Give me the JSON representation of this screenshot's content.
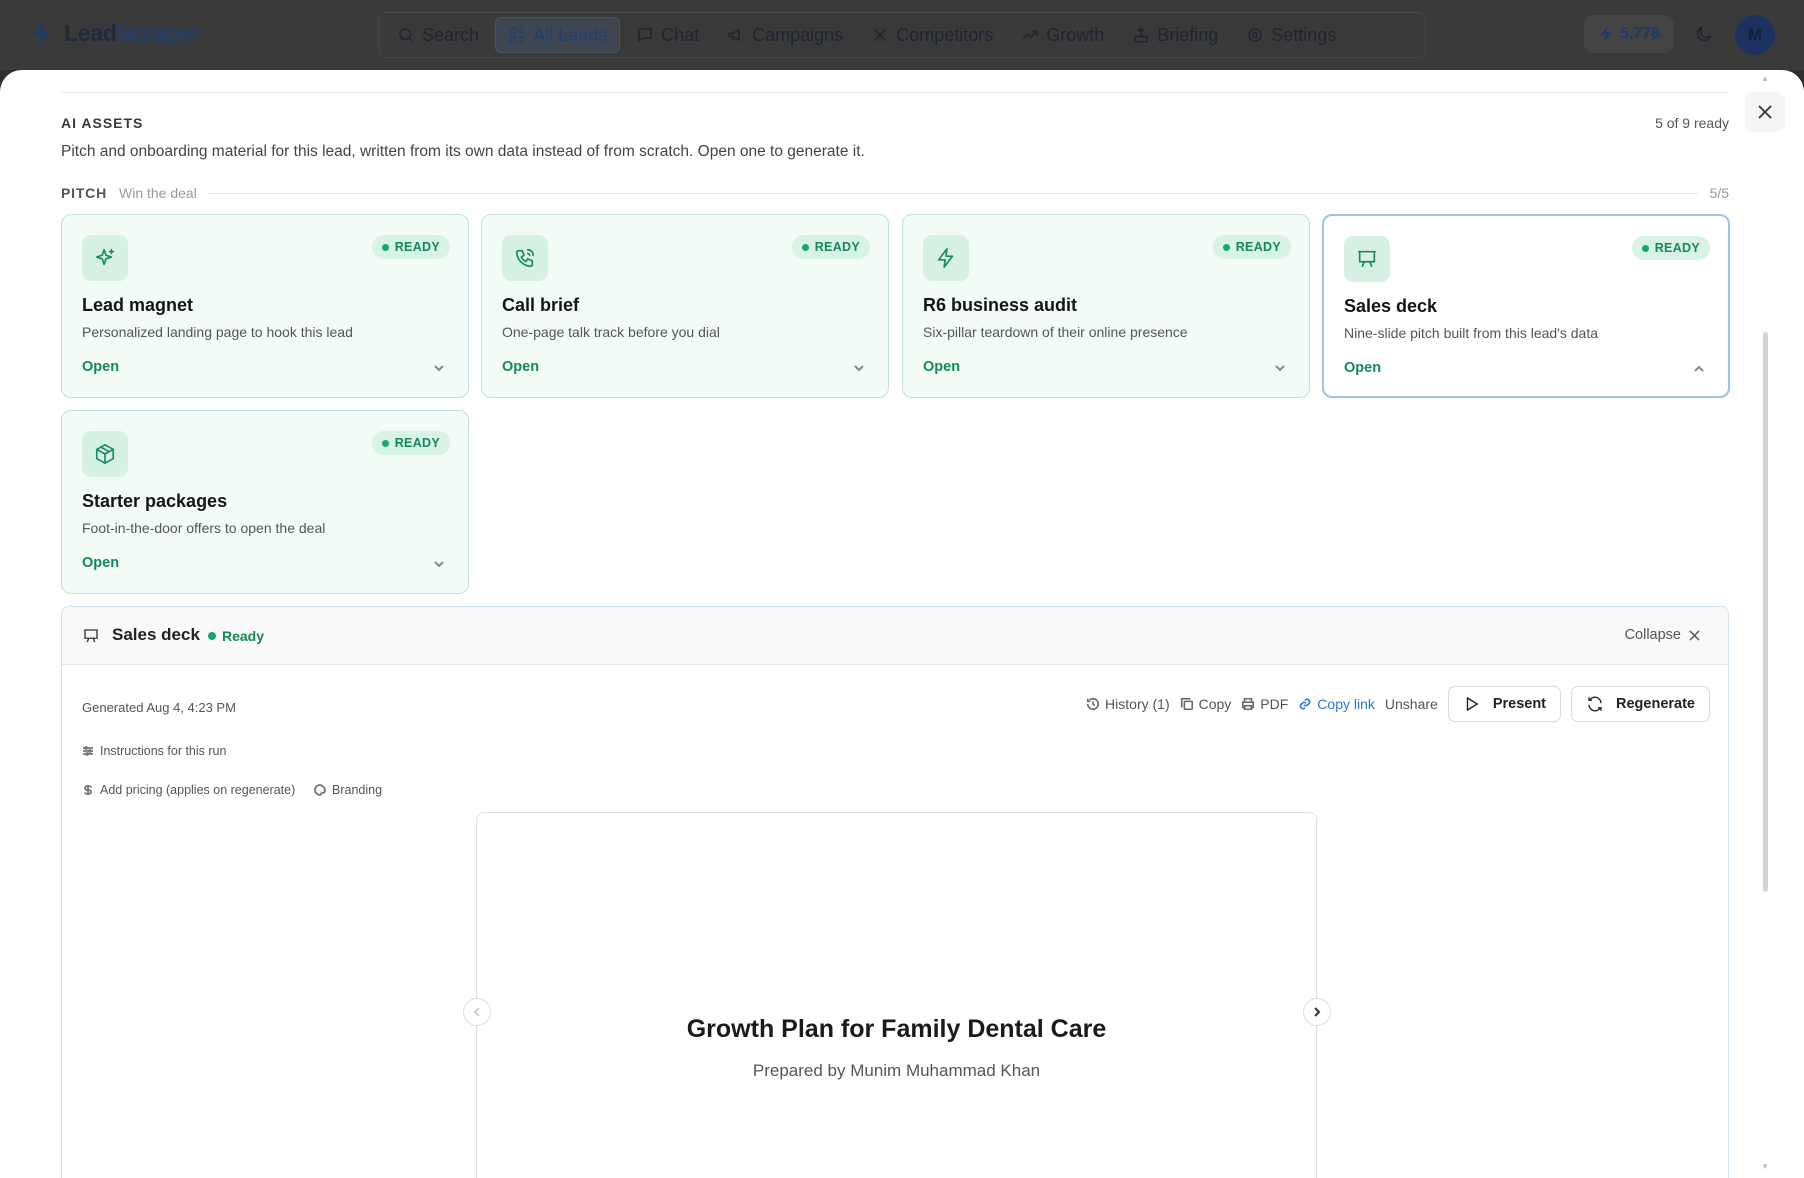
{
  "app": {
    "logo_part1": "Lead",
    "logo_part2": "Scraper"
  },
  "nav": {
    "items": [
      {
        "label": "Search",
        "icon": "search-icon"
      },
      {
        "label": "All Leads",
        "icon": "grid-list-icon",
        "active": true
      },
      {
        "label": "Chat",
        "icon": "chat-icon"
      },
      {
        "label": "Campaigns",
        "icon": "megaphone-icon"
      },
      {
        "label": "Competitors",
        "icon": "swords-icon"
      },
      {
        "label": "Growth",
        "icon": "trending-up-icon"
      },
      {
        "label": "Briefing",
        "icon": "podium-icon"
      },
      {
        "label": "Settings",
        "icon": "gear-icon"
      }
    ],
    "credits": "5,778",
    "avatar_initial": "M"
  },
  "assets": {
    "section_title": "AI ASSETS",
    "ready_count": "5 of 9 ready",
    "description": "Pitch and onboarding material for this lead, written from its own data instead of from scratch. Open one to generate it.",
    "group": {
      "label": "PITCH",
      "subtitle": "Win the deal",
      "count": "5/5"
    },
    "cards": [
      {
        "title": "Lead magnet",
        "desc": "Personalized landing page to hook this lead",
        "badge": "READY",
        "open": "Open",
        "icon": "sparkles-icon"
      },
      {
        "title": "Call brief",
        "desc": "One-page talk track before you dial",
        "badge": "READY",
        "open": "Open",
        "icon": "phone-call-icon"
      },
      {
        "title": "R6 business audit",
        "desc": "Six-pillar teardown of their online presence",
        "badge": "READY",
        "open": "Open",
        "icon": "lightning-icon"
      },
      {
        "title": "Sales deck",
        "desc": "Nine-slide pitch built from this lead's data",
        "badge": "READY",
        "open": "Open",
        "icon": "presentation-icon",
        "selected": true
      },
      {
        "title": "Starter packages",
        "desc": "Foot-in-the-door offers to open the deal",
        "badge": "READY",
        "open": "Open",
        "icon": "package-icon"
      }
    ]
  },
  "detail": {
    "title": "Sales deck",
    "status": "Ready",
    "collapse": "Collapse",
    "generated": "Generated Aug 4, 4:23 PM",
    "actions": {
      "history": "History (1)",
      "copy": "Copy",
      "pdf": "PDF",
      "copy_link": "Copy link",
      "unshare": "Unshare",
      "present": "Present",
      "regenerate": "Regenerate"
    },
    "instructions": "Instructions for this run",
    "pricing": "Add pricing (applies on regenerate)",
    "branding": "Branding",
    "slide": {
      "title": "Growth Plan for Family Dental Care",
      "subtitle": "Prepared by Munim Muhammad Khan"
    }
  },
  "colors": {
    "accent_green": "#138a55",
    "link_blue": "#2a78d6",
    "brand_navy": "#223f72"
  }
}
